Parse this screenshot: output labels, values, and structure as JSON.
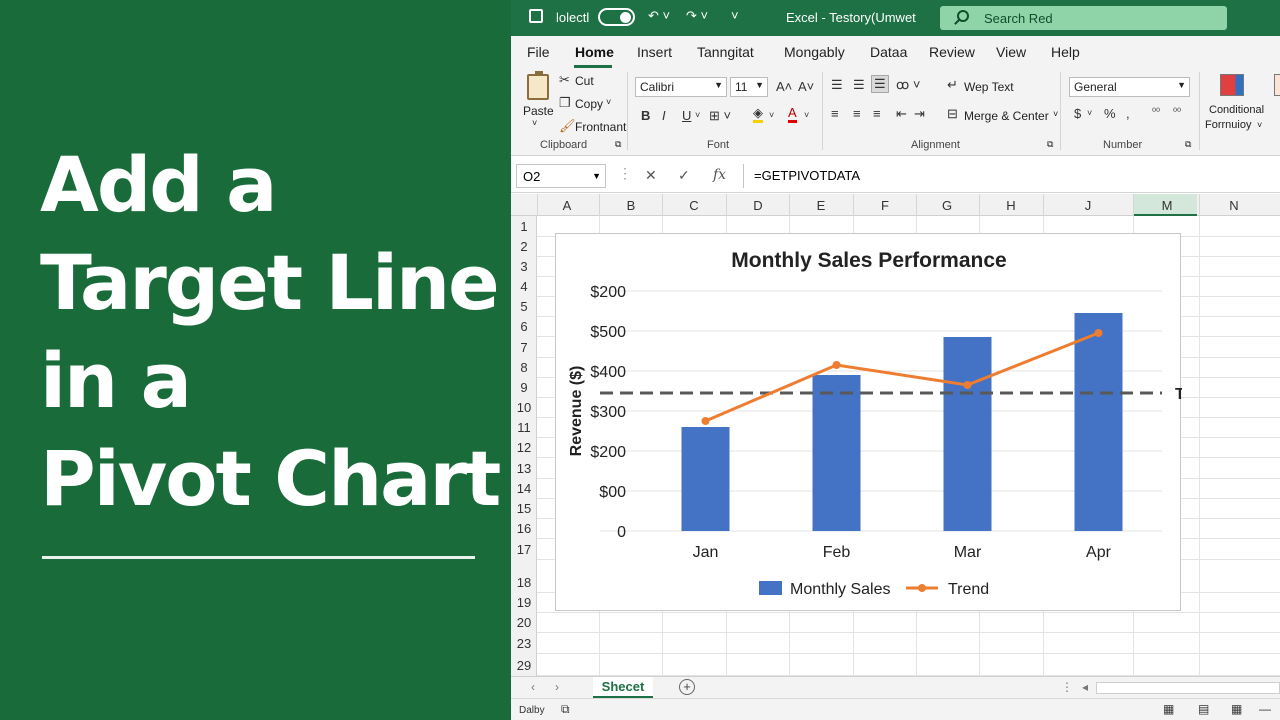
{
  "headline": {
    "lines": [
      "Add a",
      "Target Line",
      "in a",
      "Pivot Chart"
    ]
  },
  "titlebar": {
    "autosave_label": "lolectl",
    "doc_title": "Excel - Testory(Umwet",
    "search_placeholder": "Search Red"
  },
  "menu": {
    "tabs": [
      "File",
      "Home",
      "Insert",
      "Tanngitat",
      "Mongably",
      "Dataa",
      "Review",
      "View",
      "Help"
    ],
    "active": "Home"
  },
  "ribbon": {
    "clipboard": {
      "paste": "Paste",
      "cut": "Cut",
      "copy": "Copy",
      "format_painter": "Frontnant",
      "label": "Clipboard"
    },
    "font": {
      "name": "Calibri",
      "size": "11",
      "bold": "B",
      "italic": "I",
      "underline": "U",
      "label": "Font"
    },
    "alignment": {
      "wrap_text": "Wep Text",
      "merge_center": "Merge & Center",
      "label": "Alignment"
    },
    "number": {
      "format": "General",
      "currency": "$",
      "percent": "%",
      "label": "Number"
    },
    "styles": {
      "conditional_line1": "Conditional",
      "conditional_line2": "Forrnuioy"
    }
  },
  "formula_bar": {
    "name_box": "O2",
    "fx": "fx",
    "formula": "=GETPIVOTDATA"
  },
  "columns": [
    "A",
    "B",
    "C",
    "D",
    "E",
    "F",
    "G",
    "H",
    "J",
    "M",
    "N"
  ],
  "selected_column": "M",
  "rows": [
    "1",
    "2",
    "3",
    "4",
    "5",
    "6",
    "7",
    "8",
    "9",
    "10",
    "11",
    "12",
    "13",
    "14",
    "15",
    "16",
    "17",
    "18",
    "19",
    "20",
    "23",
    "29"
  ],
  "chart_data": {
    "type": "bar",
    "title": "Monthly Sales Performance",
    "ylabel": "Revenue ($)",
    "xlabel": "",
    "categories": [
      "Jan",
      "Feb",
      "Mar",
      "Apr"
    ],
    "ytick_labels": [
      "$200",
      "$500",
      "$400",
      "$300",
      "$200",
      "$00",
      "0"
    ],
    "ylim": [
      0,
      600
    ],
    "series": [
      {
        "name": "Monthly Sales",
        "type": "bar",
        "color": "#4472c4",
        "values": [
          260,
          390,
          485,
          545
        ]
      },
      {
        "name": "Trend",
        "type": "line",
        "color": "#ed7d31",
        "values": [
          275,
          415,
          365,
          495
        ]
      }
    ],
    "target": {
      "label": "Target Goal",
      "value": 345,
      "color": "#595959",
      "style": "dashed"
    },
    "grid": true,
    "legend": "bottom"
  },
  "sheets": {
    "active": "Shecet"
  },
  "status": {
    "left": "Dalby"
  }
}
